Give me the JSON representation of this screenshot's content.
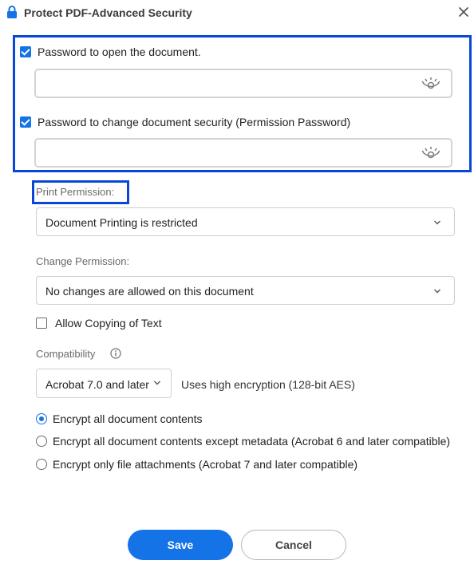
{
  "dialog": {
    "title": "Protect PDF-Advanced Security",
    "lock_icon": "lock-icon",
    "close_icon": "close-icon"
  },
  "passwords": {
    "open": {
      "label": "Password to open the document.",
      "checked": true,
      "value": "",
      "eye_icon": "eye-hidden-icon"
    },
    "permission": {
      "label": "Password to change document security (Permission Password)",
      "checked": true,
      "value": "",
      "eye_icon": "eye-hidden-icon"
    }
  },
  "print_permission": {
    "label": "Print Permission:",
    "selected": "Document Printing is restricted"
  },
  "change_permission": {
    "label": "Change Permission:",
    "selected": "No changes are allowed on this document"
  },
  "allow_copying": {
    "label": "Allow Copying of Text",
    "checked": false
  },
  "compatibility": {
    "label": "Compatibility",
    "info_icon": "info-icon",
    "selected": "Acrobat 7.0 and later",
    "hint": "Uses high encryption (128-bit AES)"
  },
  "encrypt_options": [
    {
      "label": "Encrypt all document contents",
      "selected": true
    },
    {
      "label": "Encrypt all document contents except metadata (Acrobat 6 and later compatible)",
      "selected": false
    },
    {
      "label": "Encrypt only file attachments (Acrobat 7 and later compatible)",
      "selected": false
    }
  ],
  "buttons": {
    "save": "Save",
    "cancel": "Cancel"
  },
  "colors": {
    "accent": "#1473e6",
    "highlight": "#0a47d6"
  }
}
